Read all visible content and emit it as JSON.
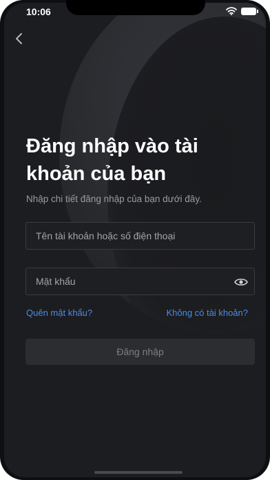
{
  "status_bar": {
    "time": "10:06"
  },
  "header": {
    "back_icon": "chevron-left-icon"
  },
  "login": {
    "title": "Đăng nhập vào tài khoản của bạn",
    "subtitle": "Nhập chi tiết đăng nhập của bạn dưới đây.",
    "username_placeholder": "Tên tài khoản hoặc số điện thoại",
    "username_value": "",
    "password_placeholder": "Mật khẩu",
    "password_value": "",
    "password_toggle_icon": "eye-icon",
    "forgot_password_label": "Quên mật khẩu?",
    "signup_label": "Không có tài khoản?",
    "submit_label": "Đăng nhập"
  },
  "colors": {
    "background": "#1c1d20",
    "link": "#4d8be8",
    "button_disabled": "#2b2d31",
    "text_primary": "#ffffff",
    "text_secondary": "#9a9ca0"
  }
}
